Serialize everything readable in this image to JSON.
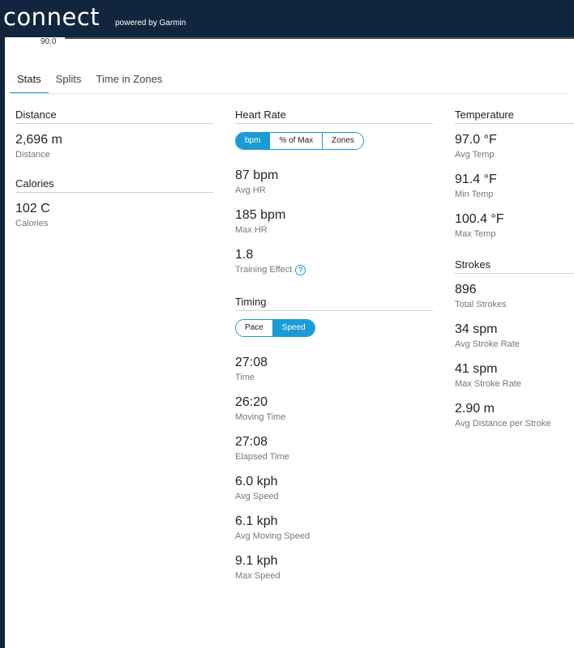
{
  "header": {
    "logo": "connect",
    "powered_by": "powered by Garmin"
  },
  "chart_strip": {
    "tick_label": "90.0"
  },
  "tabs": [
    {
      "label": "Stats",
      "active": true
    },
    {
      "label": "Splits",
      "active": false
    },
    {
      "label": "Time in Zones",
      "active": false
    }
  ],
  "distance": {
    "heading": "Distance",
    "stats": [
      {
        "value": "2,696 m",
        "label": "Distance"
      }
    ]
  },
  "calories": {
    "heading": "Calories",
    "stats": [
      {
        "value": "102 C",
        "label": "Calories"
      }
    ]
  },
  "heart_rate": {
    "heading": "Heart Rate",
    "toggle": {
      "options": [
        "bpm",
        "% of Max",
        "Zones"
      ],
      "selected": "bpm"
    },
    "stats": [
      {
        "value": "87 bpm",
        "label": "Avg HR"
      },
      {
        "value": "185 bpm",
        "label": "Max HR"
      },
      {
        "value": "1.8",
        "label": "Training Effect"
      }
    ]
  },
  "timing": {
    "heading": "Timing",
    "toggle": {
      "options": [
        "Pace",
        "Speed"
      ],
      "selected": "Speed"
    },
    "stats": [
      {
        "value": "27:08",
        "label": "Time"
      },
      {
        "value": "26:20",
        "label": "Moving Time"
      },
      {
        "value": "27:08",
        "label": "Elapsed Time"
      },
      {
        "value": "6.0 kph",
        "label": "Avg Speed"
      },
      {
        "value": "6.1 kph",
        "label": "Avg Moving Speed"
      },
      {
        "value": "9.1 kph",
        "label": "Max Speed"
      }
    ]
  },
  "temperature": {
    "heading": "Temperature",
    "stats": [
      {
        "value": "97.0 °F",
        "label": "Avg Temp"
      },
      {
        "value": "91.4 °F",
        "label": "Min Temp"
      },
      {
        "value": "100.4 °F",
        "label": "Max Temp"
      }
    ]
  },
  "strokes": {
    "heading": "Strokes",
    "stats": [
      {
        "value": "896",
        "label": "Total Strokes"
      },
      {
        "value": "34 spm",
        "label": "Avg Stroke Rate"
      },
      {
        "value": "41 spm",
        "label": "Max Stroke Rate"
      },
      {
        "value": "2.90 m",
        "label": "Avg Distance per Stroke"
      }
    ]
  },
  "help_icon_glyph": "?",
  "colors": {
    "accent": "#1a9ad6",
    "header_bg": "#11263e"
  }
}
